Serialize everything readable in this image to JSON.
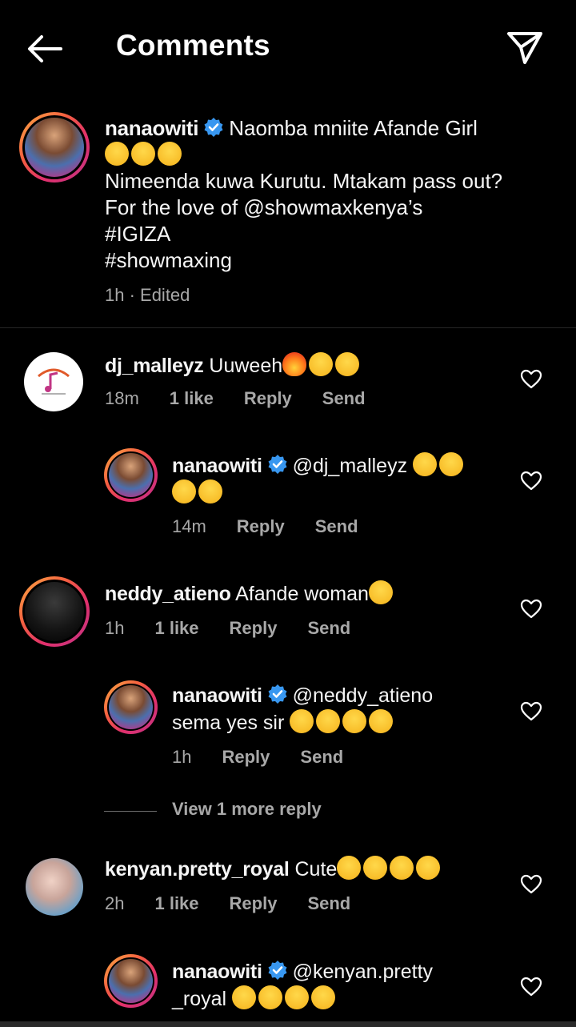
{
  "header": {
    "title": "Comments",
    "back_icon": "arrow-left-icon",
    "share_icon": "paper-plane-icon"
  },
  "caption": {
    "username": "nanaowiti",
    "text_line1": "Naomba mniite Afande Girl",
    "text_body": "Nimeenda kuwa Kurutu. Mtakam pass out? For the love of @showmaxkenya’s",
    "hashtag1": "#IGIZA",
    "hashtag2": "#showmaxing",
    "meta": "1h · Edited"
  },
  "comments": [
    {
      "username": "dj_malleyz",
      "text": "Uuweeh",
      "time": "18m",
      "likes": "1 like",
      "reply": "Reply",
      "send": "Send"
    },
    {
      "username": "nanaowiti",
      "text": "@dj_malleyz",
      "time": "14m",
      "reply": "Reply",
      "send": "Send"
    },
    {
      "username": "neddy_atieno",
      "text": "Afande woman",
      "time": "1h",
      "likes": "1 like",
      "reply": "Reply",
      "send": "Send"
    },
    {
      "username": "nanaowiti",
      "text": "@neddy_atieno",
      "text2": "sema yes sir",
      "time": "1h",
      "reply": "Reply",
      "send": "Send"
    },
    {
      "username": "kenyan.pretty_royal",
      "text": "Cute",
      "time": "2h",
      "likes": "1 like",
      "reply": "Reply",
      "send": "Send"
    },
    {
      "username": "nanaowiti",
      "text": "@kenyan.pretty",
      "text2": "_royal"
    }
  ],
  "view_more": "View 1 more reply",
  "colors": {
    "background": "#000000",
    "secondary_text": "#a8a8a8",
    "verified": "#3897f0"
  }
}
